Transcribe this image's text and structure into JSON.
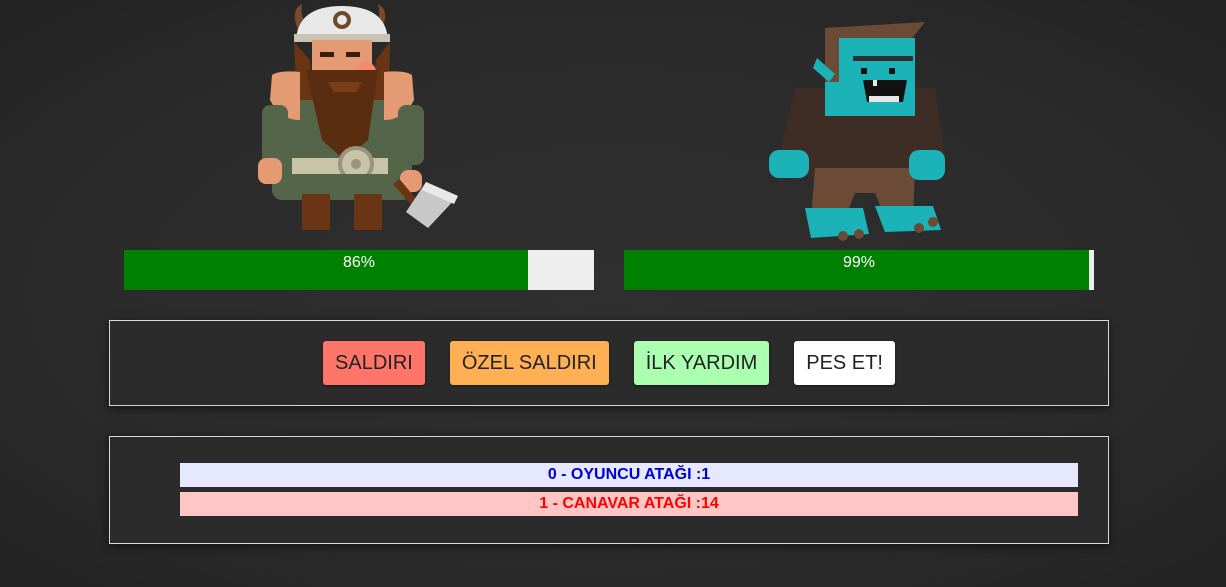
{
  "player": {
    "health_percent": 86,
    "health_label": "86%",
    "bar_color": "#008000",
    "bar_empty_color": "#eeeeee"
  },
  "monster": {
    "health_percent": 99,
    "health_label": "99%",
    "bar_color": "#008000",
    "bar_empty_color": "#eeeeee"
  },
  "controls": {
    "attack": {
      "label": "SALDIRI",
      "color": "#ff7569"
    },
    "special_attack": {
      "label": "ÖZEL SALDIRI",
      "color": "#ffb054"
    },
    "heal": {
      "label": "İLK YARDIM",
      "color": "#aaffb0"
    },
    "give_up": {
      "label": "PES ET!",
      "color": "#ffffff"
    }
  },
  "log": [
    {
      "text": "0 - OYUNCU ATAĞI :1",
      "type": "player"
    },
    {
      "text": "1 - CANAVAR ATAĞI :14",
      "type": "monster"
    }
  ]
}
